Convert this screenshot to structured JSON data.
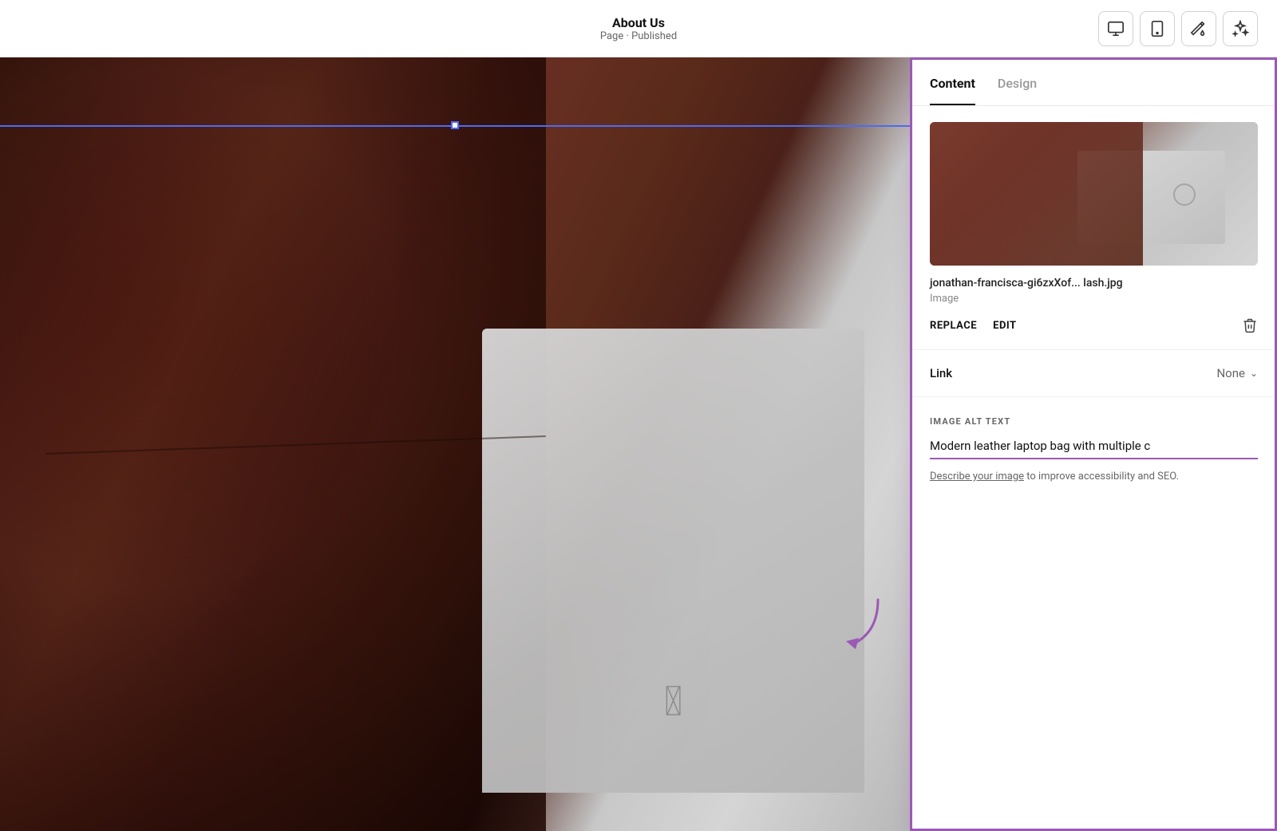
{
  "topbar": {
    "page_name": "About Us",
    "page_status": "Page · Published"
  },
  "toolbar_icons": {
    "desktop_label": "Desktop view",
    "mobile_label": "Mobile view",
    "paint_label": "Design tools",
    "magic_label": "AI tools"
  },
  "panel": {
    "tab_content": "Content",
    "tab_design": "Design",
    "image": {
      "filename": "jonathan-francisca-gi6zxXof...  lash.jpg",
      "type": "Image",
      "replace_label": "REPLACE",
      "edit_label": "EDIT"
    },
    "link": {
      "label": "Link",
      "value": "None"
    },
    "alt_text": {
      "section_label": "IMAGE ALT TEXT",
      "value": "Modern leather laptop bag with multiple c",
      "hint_link": "Describe your image",
      "hint_text": " to improve accessibility and SEO."
    }
  }
}
